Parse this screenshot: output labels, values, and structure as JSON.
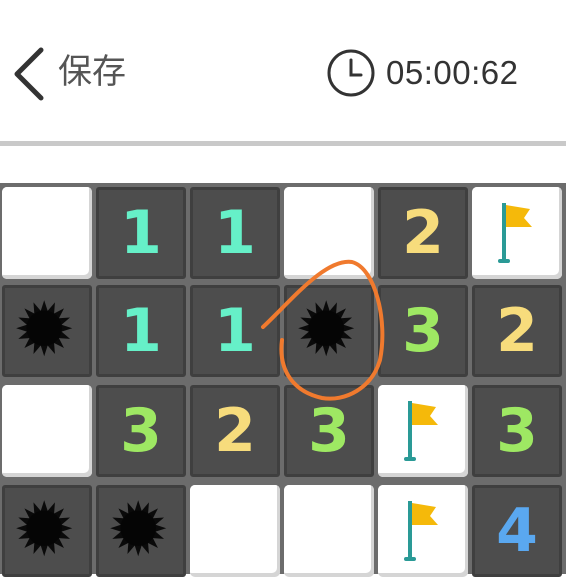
{
  "header": {
    "back_label": "保存",
    "timer": "05:00:62"
  },
  "colors": {
    "num1": "#66f0c8",
    "num2": "#f7dc7c",
    "num3": "#9ee863",
    "num4": "#5aa8f0",
    "annotation": "#f07a2e",
    "flag": "#f5b90a",
    "flag_pole": "#2a9a96"
  },
  "board": {
    "rows": [
      [
        {
          "state": "covered",
          "icon": ""
        },
        {
          "state": "open",
          "value": "1"
        },
        {
          "state": "open",
          "value": "1"
        },
        {
          "state": "covered",
          "icon": ""
        },
        {
          "state": "open",
          "value": "2"
        },
        {
          "state": "covered",
          "icon": "flag-icon"
        }
      ],
      [
        {
          "state": "open",
          "icon": "mine-icon"
        },
        {
          "state": "open",
          "value": "1"
        },
        {
          "state": "open",
          "value": "1"
        },
        {
          "state": "open",
          "icon": "mine-icon"
        },
        {
          "state": "open",
          "value": "3"
        },
        {
          "state": "open",
          "value": "2"
        }
      ],
      [
        {
          "state": "covered",
          "icon": ""
        },
        {
          "state": "open",
          "value": "3"
        },
        {
          "state": "open",
          "value": "2"
        },
        {
          "state": "open",
          "value": "3"
        },
        {
          "state": "covered",
          "icon": "flag-icon"
        },
        {
          "state": "open",
          "value": "3"
        }
      ],
      [
        {
          "state": "open",
          "icon": "mine-icon"
        },
        {
          "state": "open",
          "icon": "mine-icon"
        },
        {
          "state": "covered",
          "icon": ""
        },
        {
          "state": "covered",
          "icon": ""
        },
        {
          "state": "covered",
          "icon": "flag-icon"
        },
        {
          "state": "open",
          "value": "4"
        }
      ]
    ]
  }
}
